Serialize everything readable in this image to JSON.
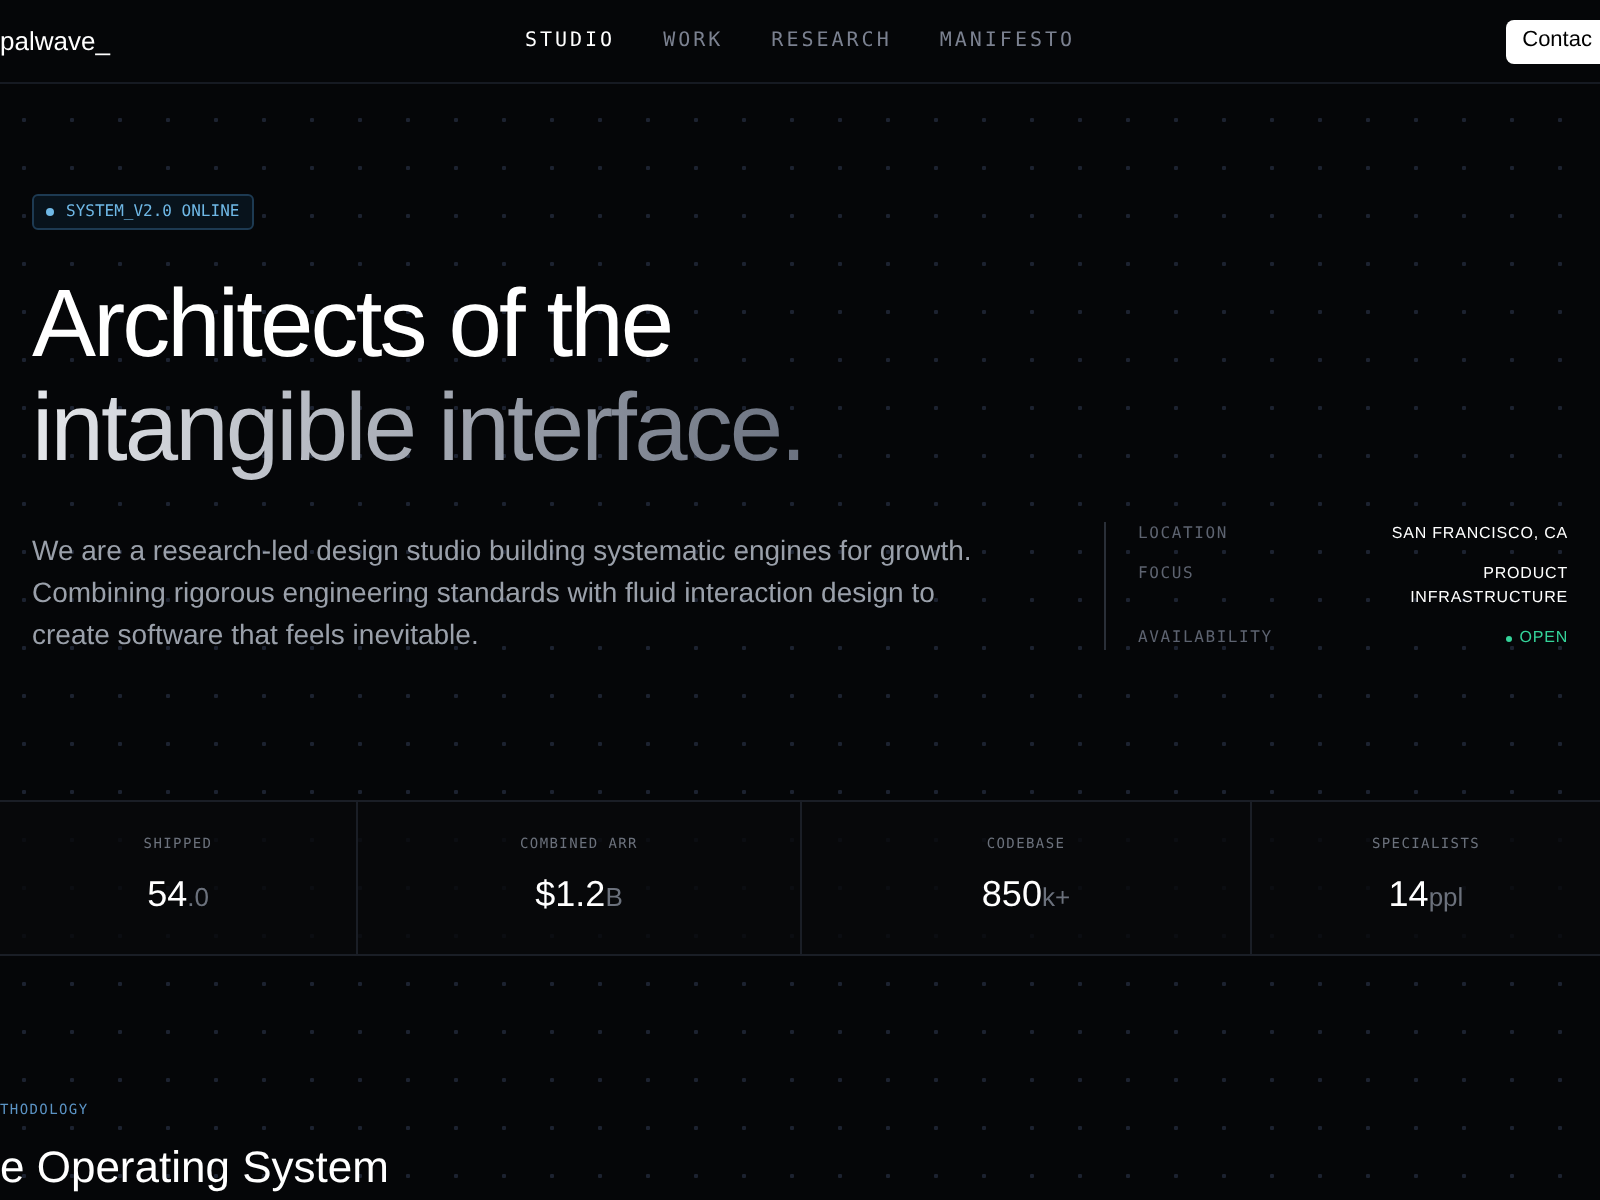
{
  "header": {
    "logo": "palwave_",
    "nav": [
      {
        "label": "STUDIO",
        "selected": true
      },
      {
        "label": "WORK",
        "selected": false
      },
      {
        "label": "RESEARCH",
        "selected": false
      },
      {
        "label": "MANIFESTO",
        "selected": false
      }
    ],
    "cta": "Contac"
  },
  "hero": {
    "badge": "SYSTEM_V2.0 ONLINE",
    "title_line_1": "Architects of the",
    "title_line_2": "intangible interface.",
    "description": "We are a research-led design studio building systematic engines for growth. Combining rigorous engineering standards with fluid interaction design to create software that feels inevitable.",
    "facts": [
      {
        "label": "LOCATION",
        "value": "SAN FRANCISCO, CA",
        "kind": "text"
      },
      {
        "label": "FOCUS",
        "value": "PRODUCT INFRASTRUCTURE",
        "kind": "text"
      },
      {
        "label": "AVAILABILITY",
        "value": "OPEN",
        "kind": "status",
        "color": "#34d399"
      }
    ]
  },
  "stats": [
    {
      "label": "SHIPPED",
      "value": "54",
      "unit": ".0"
    },
    {
      "label": "COMBINED ARR",
      "value": "$1.2",
      "unit": "B"
    },
    {
      "label": "CODEBASE",
      "value": "850",
      "unit": "k+"
    },
    {
      "label": "SPECIALISTS",
      "value": "14",
      "unit": "ppl"
    }
  ],
  "methodology": {
    "eyebrow": "THODOLOGY",
    "title": "e Operating System"
  }
}
